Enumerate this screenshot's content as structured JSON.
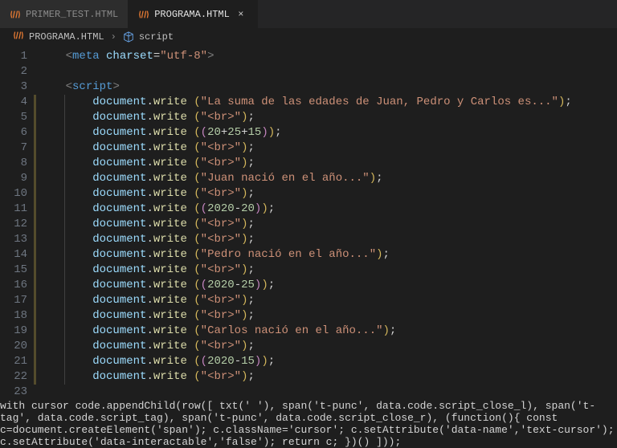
{
  "tabs": [
    {
      "label": "PRIMER_TEST.HTML",
      "active": false
    },
    {
      "label": "PROGRAMA.HTML",
      "active": true,
      "closable": true
    }
  ],
  "breadcrumb": {
    "file": "PROGRAMA.HTML",
    "symbol": "script"
  },
  "colors": {
    "tag": "#569cd6",
    "string": "#ce9178",
    "identifier": "#9cdcfe",
    "function": "#dcdcaa",
    "number": "#b5cea8",
    "punctuation": "#808080"
  },
  "code": {
    "obj": "document",
    "dot": ".",
    "fn": "write",
    "meta_open": "<",
    "meta_tag": "meta",
    "meta_attr": "charset",
    "meta_eq": "=",
    "meta_val": "\"utf-8\"",
    "meta_close": ">",
    "script_open_l": "<",
    "script_tag": "script",
    "script_open_r": ">",
    "script_close_l": "</",
    "script_close_r": ">",
    "lines": [
      "\"La suma de las edades de Juan, Pedro y Carlos es...\"",
      "\"<br>\"",
      "(20+25+15)",
      "\"<br>\"",
      "\"<br>\"",
      "\"Juan nació en el año...\"",
      "\"<br>\"",
      "(2020-20)",
      "\"<br>\"",
      "\"<br>\"",
      "\"Pedro nació en el año...\"",
      "\"<br>\"",
      "(2020-25)",
      "\"<br>\"",
      "\"<br>\"",
      "\"Carlos nació en el año...\"",
      "\"<br>\"",
      "(2020-15)",
      "\"<br>\""
    ],
    "line_numbers": [
      "1",
      "2",
      "3",
      "4",
      "5",
      "6",
      "7",
      "8",
      "9",
      "10",
      "11",
      "12",
      "13",
      "14",
      "15",
      "16",
      "17",
      "18",
      "19",
      "20",
      "21",
      "22",
      "23"
    ]
  }
}
